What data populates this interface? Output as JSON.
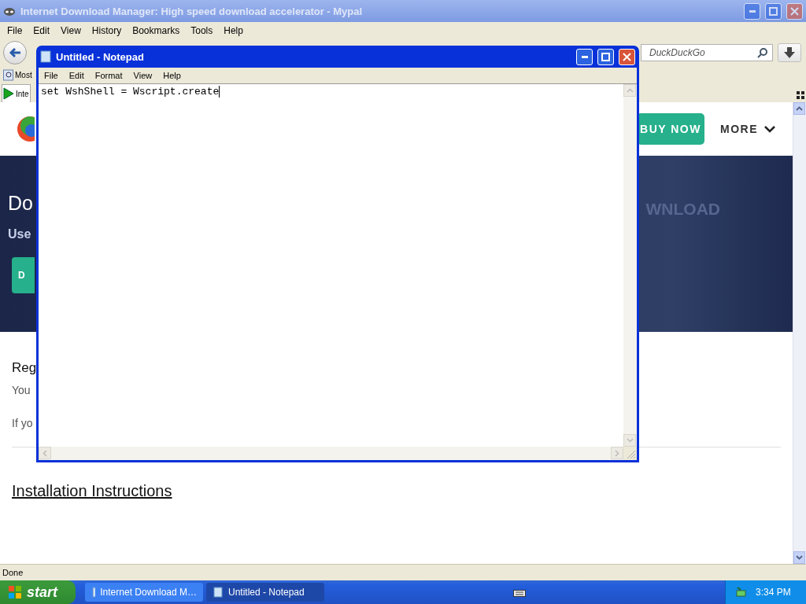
{
  "browser": {
    "title": "Internet Download Manager: High speed download accelerator - Mypal",
    "menu": [
      "File",
      "Edit",
      "View",
      "History",
      "Bookmarks",
      "Tools",
      "Help"
    ],
    "search": {
      "placeholder": "DuckDuckGo"
    },
    "bookmarks": [
      {
        "label": "Most"
      }
    ],
    "tabs": [
      {
        "label": "Inte",
        "selected": true
      }
    ],
    "page": {
      "nav": [
        {
          "label": "BUY NOW",
          "kind": "button"
        },
        {
          "label": "MORE",
          "kind": "dropdown"
        }
      ],
      "banner": {
        "heading": "Do",
        "subheading": "Use",
        "button": "D",
        "ghost_text": "WNLOAD"
      },
      "section": {
        "heading": "Reg",
        "lines": [
          "You",
          "If yo"
        ]
      },
      "link": "Installation Instructions"
    },
    "status": "Done"
  },
  "notepad": {
    "title": "Untitled - Notepad",
    "menu": [
      "File",
      "Edit",
      "Format",
      "View",
      "Help"
    ],
    "text": "set WshShell = Wscript.create"
  },
  "taskbar": {
    "start": "start",
    "tasks": [
      {
        "label": "Internet Download M…",
        "selected": false
      },
      {
        "label": "Untitled - Notepad",
        "selected": true
      }
    ],
    "clock": "3:34 PM"
  }
}
